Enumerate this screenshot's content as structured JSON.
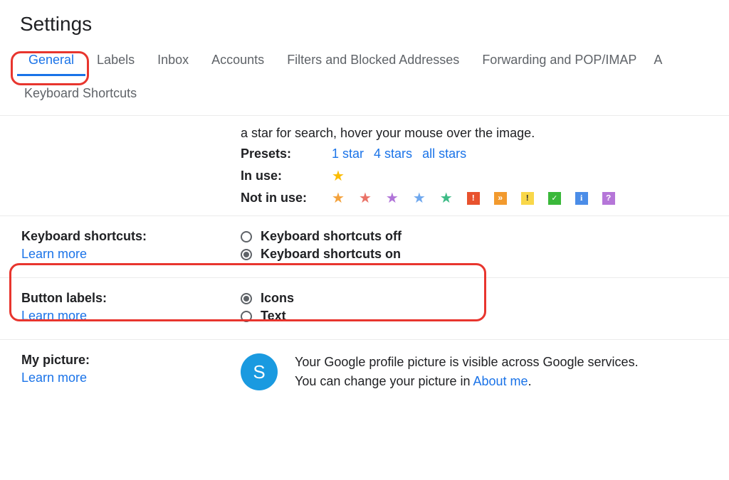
{
  "page_title": "Settings",
  "tabs": {
    "general": "General",
    "labels": "Labels",
    "inbox": "Inbox",
    "accounts": "Accounts",
    "filters": "Filters and Blocked Addresses",
    "forwarding": "Forwarding and POP/IMAP",
    "addons_trunc": "A",
    "kbs": "Keyboard Shortcuts"
  },
  "stars": {
    "hint_tail": "a star for search, hover your mouse over the image.",
    "presets_label": "Presets:",
    "preset_1": "1 star",
    "preset_4": "4 stars",
    "preset_all": "all stars",
    "in_use_label": "In use:",
    "not_in_use_label": "Not in use:"
  },
  "kbs_section": {
    "title": "Keyboard shortcuts:",
    "learn": "Learn more",
    "opt_off": "Keyboard shortcuts off",
    "opt_on": "Keyboard shortcuts on"
  },
  "btn_labels": {
    "title": "Button labels:",
    "learn": "Learn more",
    "opt_icons": "Icons",
    "opt_text": "Text"
  },
  "my_picture": {
    "title": "My picture:",
    "learn": "Learn more",
    "avatar_letter": "S",
    "desc1": "Your Google profile picture is visible across Google services.",
    "desc2a": "You can change your picture in ",
    "desc2link": "About me",
    "desc2b": "."
  }
}
